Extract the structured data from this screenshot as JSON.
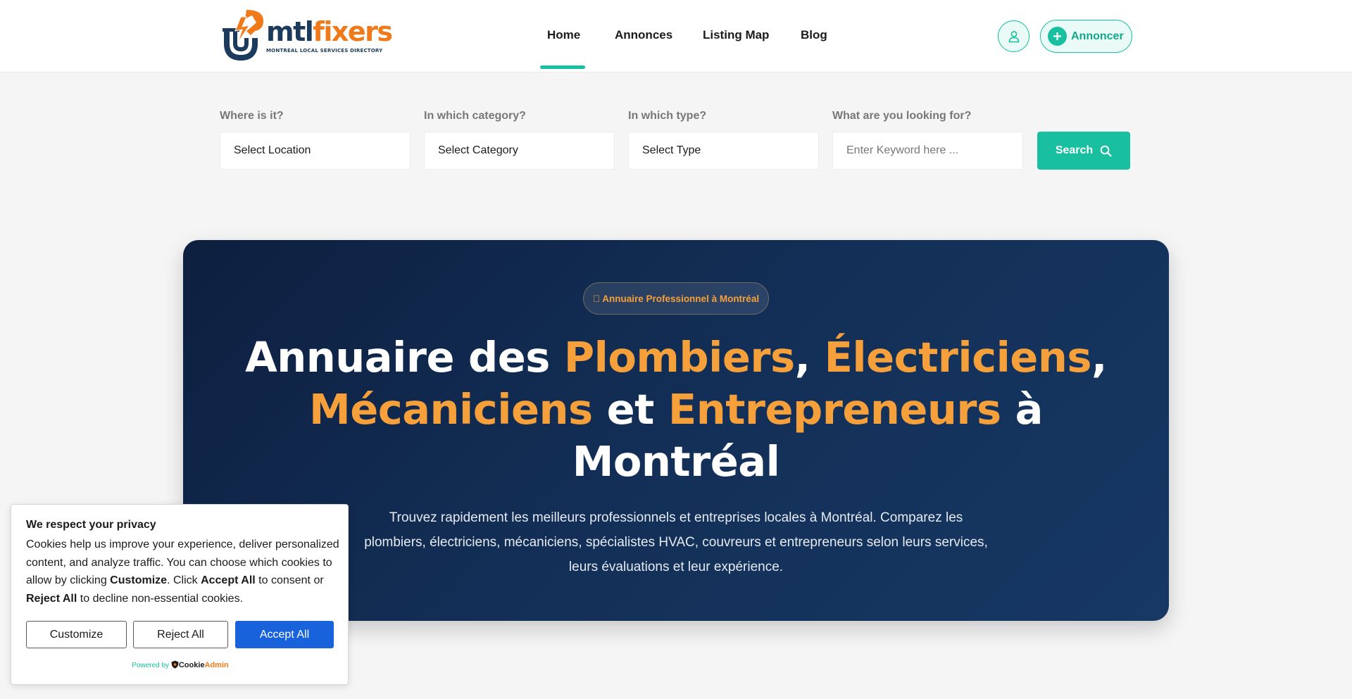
{
  "header": {
    "logo": {
      "brand_part1": "mtl",
      "brand_part2": "fixers",
      "tagline": "MONTREAL LOCAL SERVICES DIRECTORY"
    },
    "nav": [
      {
        "label": "Home",
        "active": true
      },
      {
        "label": "Annonces",
        "active": false
      },
      {
        "label": "Listing Map",
        "active": false
      },
      {
        "label": "Blog",
        "active": false
      }
    ],
    "user_icon": "user-icon",
    "annoncer_label": "Annoncer"
  },
  "search": {
    "location_label": "Where is it?",
    "location_value": "Select Location",
    "category_label": "In which category?",
    "category_value": "Select Category",
    "type_label": "In which type?",
    "type_value": "Select Type",
    "keyword_label": "What are you looking for?",
    "keyword_placeholder": "Enter Keyword here ...",
    "button_label": "Search"
  },
  "hero": {
    "badge": "\u0000 Annuaire Professionnel à Montréal",
    "title": {
      "w1": "Annuaire des ",
      "h1": "Plombiers",
      "w2": ", ",
      "h2": "Électriciens",
      "w3": ", ",
      "h3": "Mécaniciens",
      "w4": " et ",
      "h4": "Entrepreneurs",
      "w5": " à Montréal"
    },
    "description": "Trouvez rapidement les meilleurs professionnels et entreprises locales à Montréal. Comparez les plombiers, électriciens, mécaniciens, spécialistes HVAC, couvreurs et entrepreneurs selon leurs services, leurs évaluations et leur expérience."
  },
  "cookie_banner": {
    "title": "We respect your privacy",
    "text_part1": "Cookies help us improve your experience, deliver personalized content, and analyze traffic. You can choose which cookies to allow by clicking ",
    "text_bold1": "Customize",
    "text_part2": ". Click ",
    "text_bold2": "Accept All",
    "text_part3": " to consent or ",
    "text_bold3": "Reject All",
    "text_part4": " to decline non-essential cookies.",
    "customize_label": "Customize",
    "reject_label": "Reject All",
    "accept_label": "Accept All",
    "powered_by": "Powered by",
    "powered_brand1": "Cookie",
    "powered_brand2": "Admin"
  },
  "colors": {
    "accent": "#18c0a0",
    "brand_orange": "#f5a03a",
    "hero_bg": "#132f57",
    "accept_blue": "#1863dc"
  }
}
